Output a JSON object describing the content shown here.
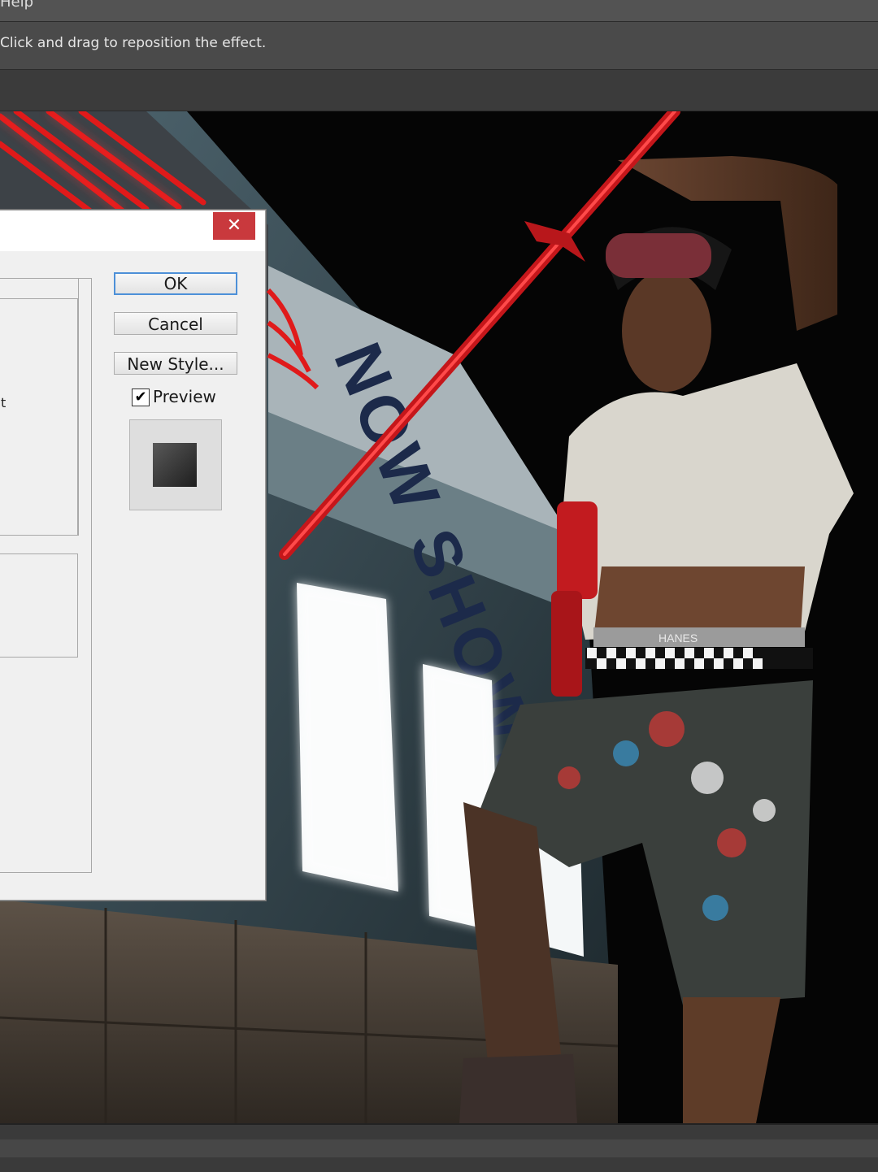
{
  "menubar": {
    "help": "Help"
  },
  "options_bar": {
    "hint": "Click and drag to reposition the effect."
  },
  "dialog": {
    "close_glyph": "✕",
    "buttons": {
      "ok": "OK",
      "cancel": "Cancel",
      "new_style": "New Style..."
    },
    "preview": {
      "label": "Preview",
      "checked": true,
      "check_glyph": "✔"
    },
    "clipped_text": "t"
  },
  "canvas": {
    "marquee": {
      "text": "NOW SHOWING"
    },
    "underwear_text": "HANES"
  },
  "colors": {
    "menubar": "#535353",
    "canvas_bg": "#050505",
    "close_button": "#c9393d",
    "neon_red": "#e01a1a",
    "neon_blue": "#29b6ff"
  }
}
